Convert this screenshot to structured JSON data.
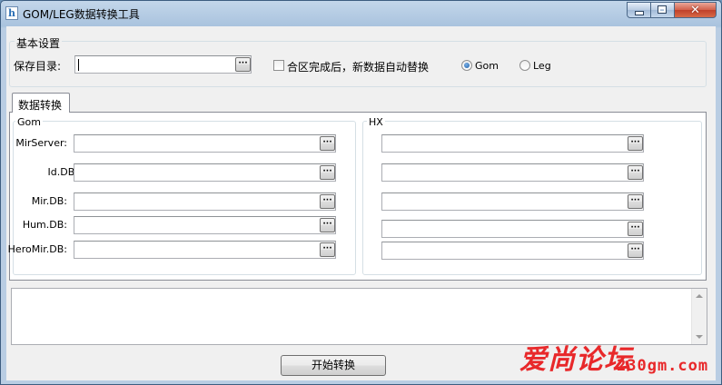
{
  "window": {
    "title": "GOM/LEG数据转换工具",
    "app_icon_letter": "h",
    "close_glyph": "✕"
  },
  "basic_settings": {
    "group_label": "基本设置",
    "save_dir_label": "保存目录:",
    "save_dir_value": "",
    "browse_label": "···",
    "auto_replace_label": "合区完成后，新数据自动替换",
    "auto_replace_checked": false,
    "format_options": [
      {
        "label": "Gom",
        "selected": true
      },
      {
        "label": "Leg",
        "selected": false
      }
    ]
  },
  "tabs": [
    {
      "label": "数据转换",
      "active": true
    }
  ],
  "gom_group": {
    "label": "Gom",
    "fields": [
      {
        "label": "MirServer:",
        "value": ""
      },
      {
        "label": "Id.DB:",
        "value": ""
      },
      {
        "label": "Mir.DB:",
        "value": ""
      },
      {
        "label": "Hum.DB:",
        "value": ""
      },
      {
        "label": "HeroMir.DB:",
        "value": ""
      }
    ]
  },
  "hx_group": {
    "label": "HX",
    "fields": [
      {
        "value": ""
      },
      {
        "value": ""
      },
      {
        "value": ""
      },
      {
        "value": ""
      },
      {
        "value": ""
      }
    ]
  },
  "log": {
    "value": ""
  },
  "start_button": {
    "label": "开始转换"
  },
  "watermark": {
    "text_cn": "爱尚论坛",
    "text_url": "230gm.com",
    "color": "#e8282a"
  }
}
